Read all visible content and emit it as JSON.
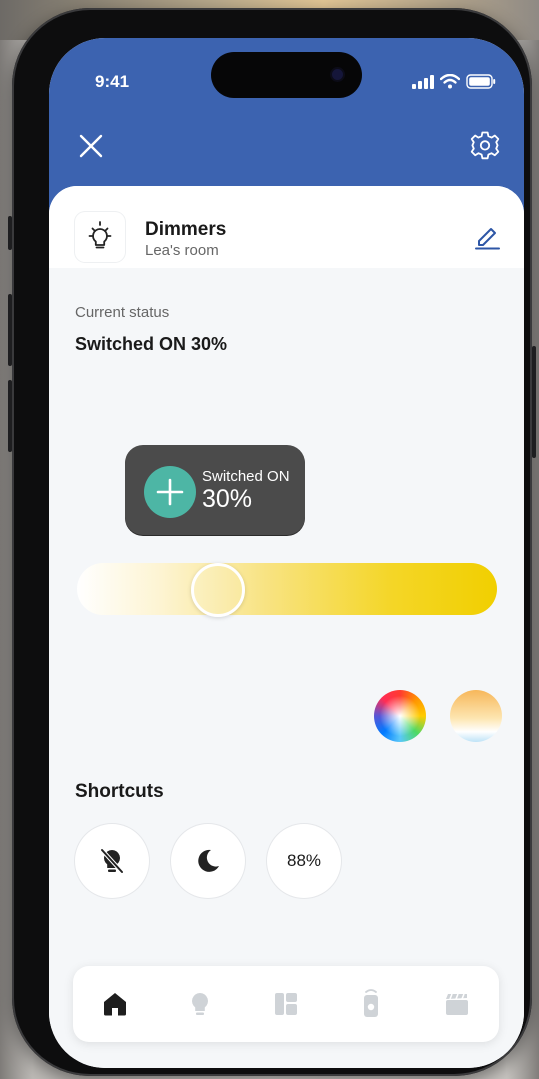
{
  "status_bar": {
    "time": "9:41"
  },
  "header": {
    "background_color": "#3c63b0",
    "close_icon": "close-icon",
    "settings_icon": "gear-icon"
  },
  "device": {
    "name": "Dimmers",
    "room": "Lea's room",
    "icon": "lightbulb-icon"
  },
  "status": {
    "label": "Current status",
    "value": "Switched ON 30%"
  },
  "tooltip": {
    "line1": "Switched ON",
    "line2": "30%"
  },
  "slider": {
    "level_percent": 30
  },
  "color_controls": [
    "color-wheel",
    "color-temperature"
  ],
  "shortcuts": {
    "title": "Shortcuts",
    "items": [
      {
        "icon": "lightbulb-off-icon"
      },
      {
        "icon": "moon-icon"
      },
      {
        "label": "88%"
      }
    ]
  },
  "tabbar": {
    "items": [
      "home-icon",
      "lightbulb-icon",
      "dashboard-icon",
      "remote-icon",
      "scenes-icon"
    ],
    "active": 0
  }
}
